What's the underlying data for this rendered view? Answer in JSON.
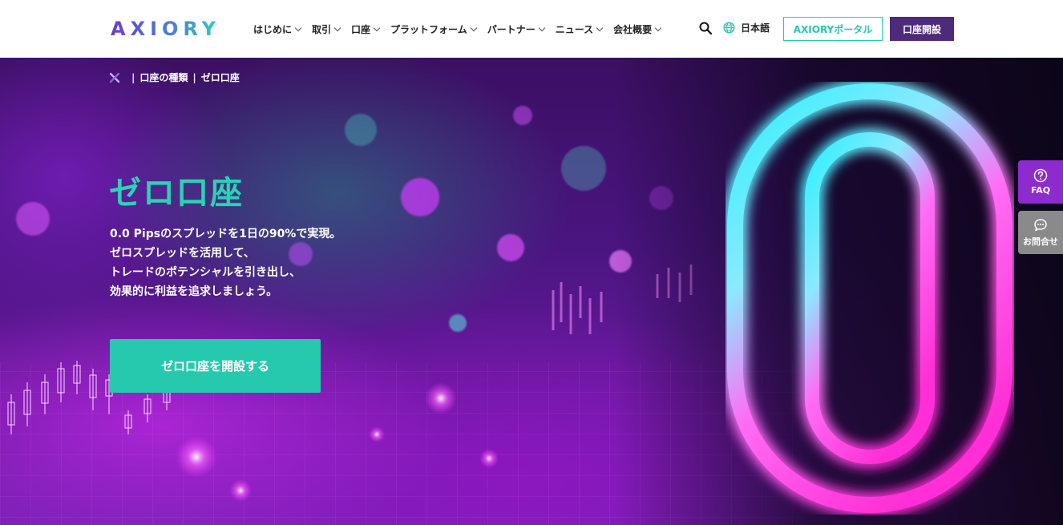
{
  "header": {
    "logo_text": "AXIORY",
    "nav": [
      {
        "label": "はじめに"
      },
      {
        "label": "取引"
      },
      {
        "label": "口座"
      },
      {
        "label": "プラットフォーム"
      },
      {
        "label": "パートナー"
      },
      {
        "label": "ニュース"
      },
      {
        "label": "会社概要"
      }
    ],
    "search_icon": "search-icon",
    "language_label": "日本語",
    "portal_button": "AXIORYポータル",
    "open_account_button": "口座開設"
  },
  "breadcrumb": {
    "home_icon": "axiory-x-icon",
    "items": [
      "口座の種類",
      "ゼロ口座"
    ]
  },
  "hero": {
    "title": "ゼロ口座",
    "description": [
      "0.0 Pipsのスプレッドを1日の90%で実現。",
      "ゼロスプレッドを活用して、",
      "トレードのポテンシャルを引き出し、",
      "効果的に利益を追求しましょう。"
    ],
    "cta_label": "ゼロ口座を開設する"
  },
  "side_buttons": {
    "faq_label": "FAQ",
    "contact_label": "お問合せ"
  },
  "colors": {
    "accent_teal": "#26c9ae",
    "brand_purple": "#4d2a7a",
    "faq_purple": "#8e2bcf"
  }
}
